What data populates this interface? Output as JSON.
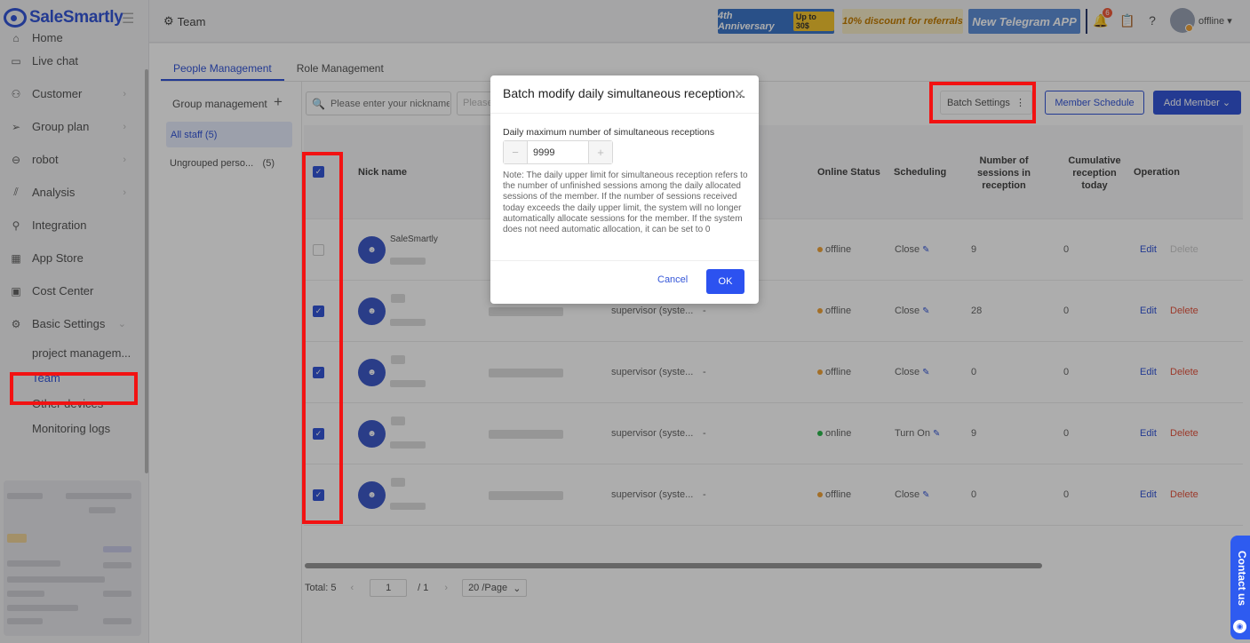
{
  "app": {
    "name": "SaleSmartly"
  },
  "sidebar": {
    "items": [
      {
        "label": "Home",
        "icon": "home-icon"
      },
      {
        "label": "Live chat",
        "icon": "chat-icon"
      },
      {
        "label": "Customer",
        "icon": "customer-icon"
      },
      {
        "label": "Group plan",
        "icon": "send-icon"
      },
      {
        "label": "robot",
        "icon": "robot-icon"
      },
      {
        "label": "Analysis",
        "icon": "chart-icon"
      },
      {
        "label": "Integration",
        "icon": "integration-icon"
      },
      {
        "label": "App Store",
        "icon": "grid-icon"
      },
      {
        "label": "Cost Center",
        "icon": "wallet-icon"
      },
      {
        "label": "Basic Settings",
        "icon": "settings-icon"
      }
    ],
    "sub_items": [
      "project managem...",
      "Team",
      "Other devices",
      "Monitoring logs"
    ],
    "active_sub": "Team"
  },
  "header": {
    "title": "Team",
    "banner1": {
      "text": "4th Anniversary",
      "pill": "Up to 30$"
    },
    "banner2": {
      "text": "10% discount for referrals"
    },
    "banner3": {
      "text": "New Telegram APP"
    },
    "notification_count": "6",
    "status": "offline"
  },
  "tabs": [
    "People Management",
    "Role Management"
  ],
  "groups": {
    "heading": "Group management",
    "all": "All staff (5)",
    "ungrouped_label": "Ungrouped perso...",
    "ungrouped_count": "(5)"
  },
  "search": {
    "placeholder": "Please enter your nickname or",
    "placeholder2": "Please"
  },
  "buttons": {
    "batch": "Batch Settings",
    "schedule": "Member Schedule",
    "add": "Add Member"
  },
  "table": {
    "headers": {
      "nick": "Nick name",
      "online": "Online Status",
      "scheduling": "Scheduling",
      "sessions": "Number of sessions in reception",
      "cumulative": "Cumulative reception today",
      "operation": "Operation"
    },
    "rows": [
      {
        "checked": false,
        "nick": "SaleSmartly",
        "role": "",
        "status": "offline",
        "scheduling": "Close",
        "sessions": "9",
        "cumulative": "0",
        "edit": "Edit",
        "delete": "Delete",
        "delete_disabled": true
      },
      {
        "checked": true,
        "nick": "",
        "role": "supervisor (syste...",
        "status": "offline",
        "scheduling": "Close",
        "sessions": "28",
        "cumulative": "0",
        "edit": "Edit",
        "delete": "Delete",
        "delete_disabled": false
      },
      {
        "checked": true,
        "nick": "",
        "role": "supervisor (syste...",
        "status": "offline",
        "scheduling": "Close",
        "sessions": "0",
        "cumulative": "0",
        "edit": "Edit",
        "delete": "Delete",
        "delete_disabled": false
      },
      {
        "checked": true,
        "nick": "",
        "role": "supervisor (syste...",
        "status": "online",
        "scheduling": "Turn On",
        "sessions": "9",
        "cumulative": "0",
        "edit": "Edit",
        "delete": "Delete",
        "delete_disabled": false
      },
      {
        "checked": true,
        "nick": "",
        "role": "supervisor (syste...",
        "status": "offline",
        "scheduling": "Close",
        "sessions": "0",
        "cumulative": "0",
        "edit": "Edit",
        "delete": "Delete",
        "delete_disabled": false
      }
    ],
    "dash": "-"
  },
  "pagination": {
    "total_label": "Total:",
    "total": "5",
    "page": "1",
    "of": "/ 1",
    "page_size": "20 /Page"
  },
  "modal": {
    "title": "Batch modify daily simultaneous reception...",
    "field_label": "Daily maximum number of simultaneous receptions",
    "value": "9999",
    "note": "Note: The daily upper limit for simultaneous reception refers to the number of unfinished sessions among the daily allocated sessions of the member. If the number of sessions received today exceeds the daily upper limit, the system will no longer automatically allocate sessions for the member. If the system does not need automatic allocation, it can be set to 0",
    "cancel": "Cancel",
    "ok": "OK"
  },
  "contact": {
    "label": "Contact us"
  },
  "colors": {
    "accent": "#3456d8",
    "highlight": "#f21212",
    "online": "#2db84d",
    "offline": "#f0a43a",
    "danger": "#e5543f"
  }
}
